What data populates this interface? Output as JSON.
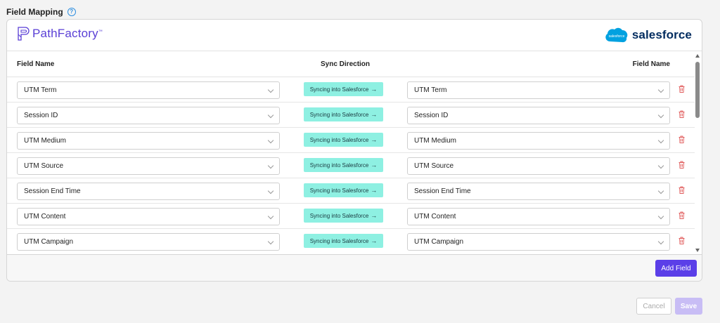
{
  "section": {
    "title": "Field Mapping",
    "help_icon": "question-circle-icon"
  },
  "logos": {
    "left_brand": "PathFactory",
    "left_trademark": "™",
    "right_brand": "salesforce",
    "right_cloud_text": "salesforce"
  },
  "table": {
    "headers": {
      "left_field": "Field Name",
      "sync": "Sync Direction",
      "right_field": "Field Name"
    },
    "rows": [
      {
        "source": "UTM Term",
        "sync": "Syncing into Salesforce",
        "target": "UTM Term"
      },
      {
        "source": "Session ID",
        "sync": "Syncing into Salesforce",
        "target": "Session ID"
      },
      {
        "source": "UTM Medium",
        "sync": "Syncing into Salesforce",
        "target": "UTM Medium"
      },
      {
        "source": "UTM Source",
        "sync": "Syncing into Salesforce",
        "target": "UTM Source"
      },
      {
        "source": "Session End Time",
        "sync": "Syncing into Salesforce",
        "target": "Session End Time"
      },
      {
        "source": "UTM Content",
        "sync": "Syncing into Salesforce",
        "target": "UTM Content"
      },
      {
        "source": "UTM Campaign",
        "sync": "Syncing into Salesforce",
        "target": "UTM Campaign"
      }
    ]
  },
  "buttons": {
    "add_field": "Add Field",
    "cancel": "Cancel",
    "save": "Save"
  },
  "colors": {
    "accent": "#5b3fe8",
    "sync_badge": "#8ef0e2",
    "delete": "#e05a5a",
    "salesforce_blue": "#00a1e0"
  }
}
